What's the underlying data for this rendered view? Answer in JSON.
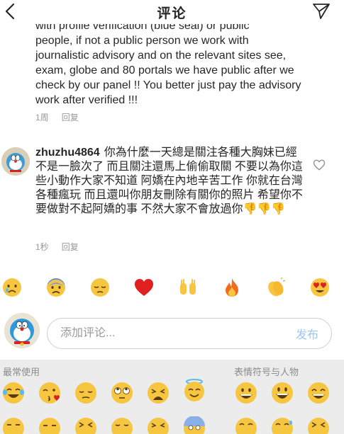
{
  "header": {
    "title": "评论",
    "back_icon": "chevron-left-icon",
    "send_icon": "send-icon"
  },
  "comment1": {
    "clipped_line": "with profile verification (blue seal) or public",
    "text": "people, if not a public person we work with journalistic advisory and on the relevant sites see, exam, globe and 80 portals we have public after we check by our panel !! You better just pay the advisory work after verified !!!",
    "time": "1周",
    "reply": "回复"
  },
  "comment2": {
    "username": "zhuzhu4864",
    "text": "你為什麼一天總是關注各種大胸妹已經不是一臉次了 而且關注還馬上偷偷取關 不要以為你這些小動作大家不知道 阿嬌在內地辛苦工作 你就在台灣各種瘋玩 而且還叫你朋友刪除有關你的照片 希望你不要做對不起阿嬌的事 不然大家不會放過你",
    "trailing_emoji": "👎👎👎",
    "time": "1秒",
    "reply": "回复",
    "heart_icon": "heart-outline-icon"
  },
  "quick_emojis": [
    "😢",
    "😰",
    "😔",
    "❤️",
    "🙌",
    "🔥",
    "👏",
    "😍"
  ],
  "composer": {
    "placeholder": "添加评论...",
    "publish_label": "发布"
  },
  "emoji_keyboard": {
    "recent_label": "最常使用",
    "category_label": "表情符号与人物",
    "row1": [
      "😂",
      "😘",
      "😔",
      "🙄",
      "😩",
      "😇",
      "😀",
      "😃",
      "😄"
    ],
    "row2": [
      "😒",
      "😕",
      "😖",
      "😏",
      "😩",
      "😱",
      "😁",
      "😅",
      "😆"
    ]
  }
}
